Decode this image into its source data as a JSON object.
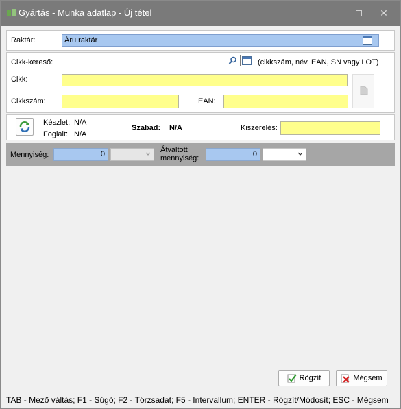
{
  "window": {
    "title": "Gyártás - Munka adatlap - Új tétel",
    "maximize_icon": "maximize-icon",
    "close_icon": "close-icon",
    "close_glyph": "✕"
  },
  "raktar": {
    "label": "Raktár:",
    "value": "Áru raktár"
  },
  "cikk_kereso": {
    "label": "Cikk-kereső:",
    "value": "",
    "hint": "(cikkszám, név, EAN, SN vagy LOT)"
  },
  "cikk": {
    "label": "Cikk:",
    "value": ""
  },
  "cikkszam": {
    "label": "Cikkszám:",
    "value": ""
  },
  "ean": {
    "label": "EAN:",
    "value": ""
  },
  "stock": {
    "keszlet_label": "Készlet:",
    "keszlet_value": "N/A",
    "foglalt_label": "Foglalt:",
    "foglalt_value": "N/A",
    "szabad_label": "Szabad:",
    "szabad_value": "N/A",
    "kiszereles_label": "Kiszerelés:",
    "kiszereles_value": ""
  },
  "quantity": {
    "mennyiseg_label": "Mennyiség:",
    "mennyiseg_value": "0",
    "atvaltott_label_line1": "Átváltott",
    "atvaltott_label_line2": "mennyiség:",
    "atvaltott_value": "0",
    "unit_selected": "",
    "atvaltott_unit_selected": ""
  },
  "buttons": {
    "save": "Rögzít",
    "cancel": "Mégsem"
  },
  "statusbar": {
    "text": "TAB - Mező váltás; F1 - Súgó; F2 - Törzsadat; F5 - Intervallum; ENTER - Rögzít/Módosít; ESC - Mégsem"
  },
  "colors": {
    "titlebar": "#7a7a7a",
    "required_field": "#ffff8c",
    "selected_field": "#a8c8f0",
    "quantity_band": "#a6a6a6"
  }
}
